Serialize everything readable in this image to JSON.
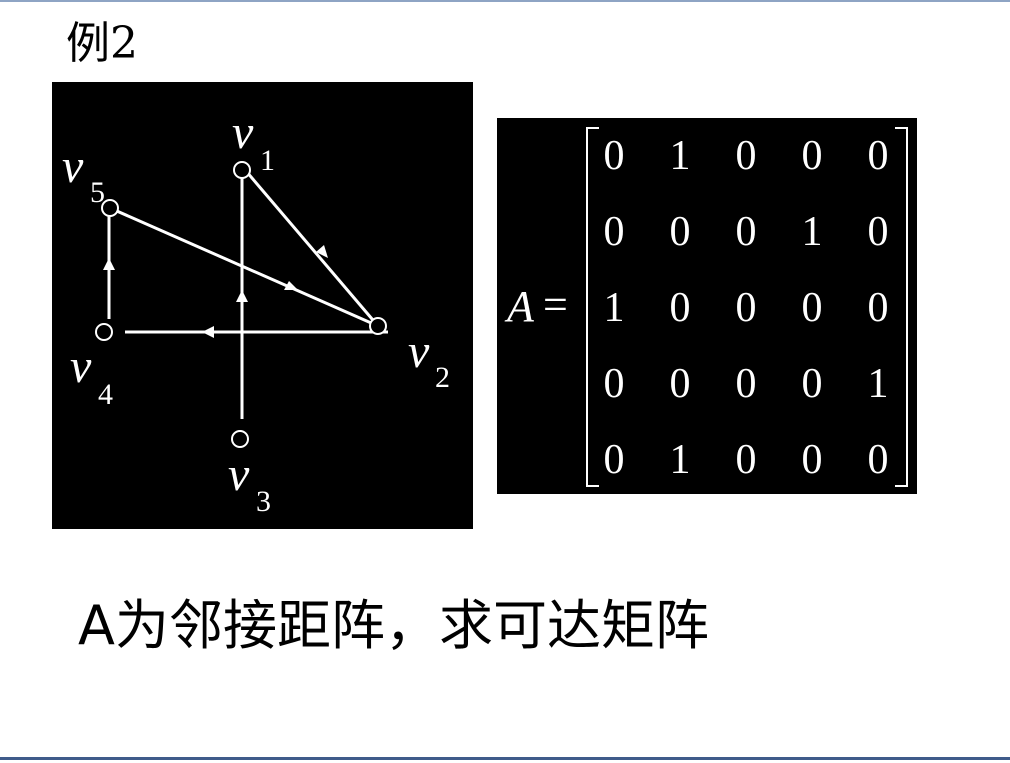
{
  "title": "例2",
  "caption": "A为邻接距阵，求可达矩阵",
  "graph": {
    "vertices": [
      {
        "id": "v1",
        "letter": "v",
        "sub": "1"
      },
      {
        "id": "v2",
        "letter": "v",
        "sub": "2"
      },
      {
        "id": "v3",
        "letter": "v",
        "sub": "3"
      },
      {
        "id": "v4",
        "letter": "v",
        "sub": "4"
      },
      {
        "id": "v5",
        "letter": "v",
        "sub": "5"
      }
    ],
    "edges": [
      {
        "from": "v1",
        "to": "v2"
      },
      {
        "from": "v2",
        "to": "v4"
      },
      {
        "from": "v3",
        "to": "v1"
      },
      {
        "from": "v4",
        "to": "v5"
      },
      {
        "from": "v5",
        "to": "v2"
      }
    ]
  },
  "matrix": {
    "name": "A",
    "equals": "=",
    "rows": [
      [
        "0",
        "1",
        "0",
        "0",
        "0"
      ],
      [
        "0",
        "0",
        "0",
        "1",
        "0"
      ],
      [
        "1",
        "0",
        "0",
        "0",
        "0"
      ],
      [
        "0",
        "0",
        "0",
        "0",
        "1"
      ],
      [
        "0",
        "1",
        "0",
        "0",
        "0"
      ]
    ]
  }
}
